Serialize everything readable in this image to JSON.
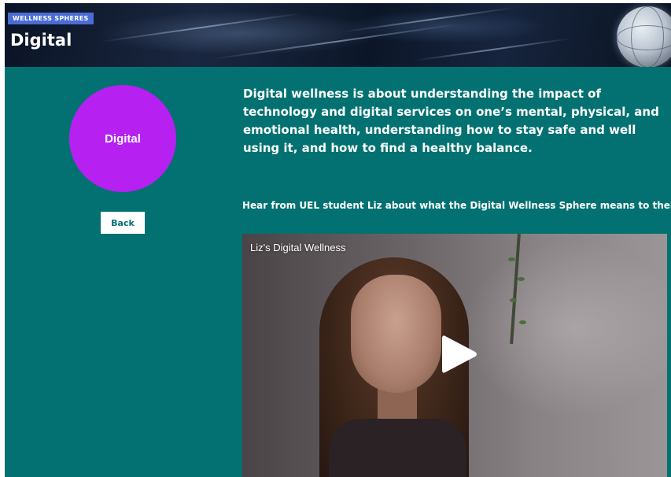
{
  "banner": {
    "tag": "WELLNESS SPHERES",
    "title": "Digital"
  },
  "sidebar": {
    "sphere_label": "Digital",
    "sphere_color": "#b620f0",
    "back_label": "Back"
  },
  "main": {
    "intro": "Digital wellness is about understanding the impact of technology and digital services on one’s mental, physical, and emotional health, understanding how to stay safe and well using it, and how to find a healthy balance.",
    "video_heading": "Hear from UEL student Liz about what the Digital Wellness Sphere means to them",
    "video": {
      "title": "Liz's Digital Wellness",
      "play_icon": "play-icon"
    }
  },
  "colors": {
    "background": "#037171",
    "tag": "#4a6cd4",
    "text": "#ffffff"
  }
}
